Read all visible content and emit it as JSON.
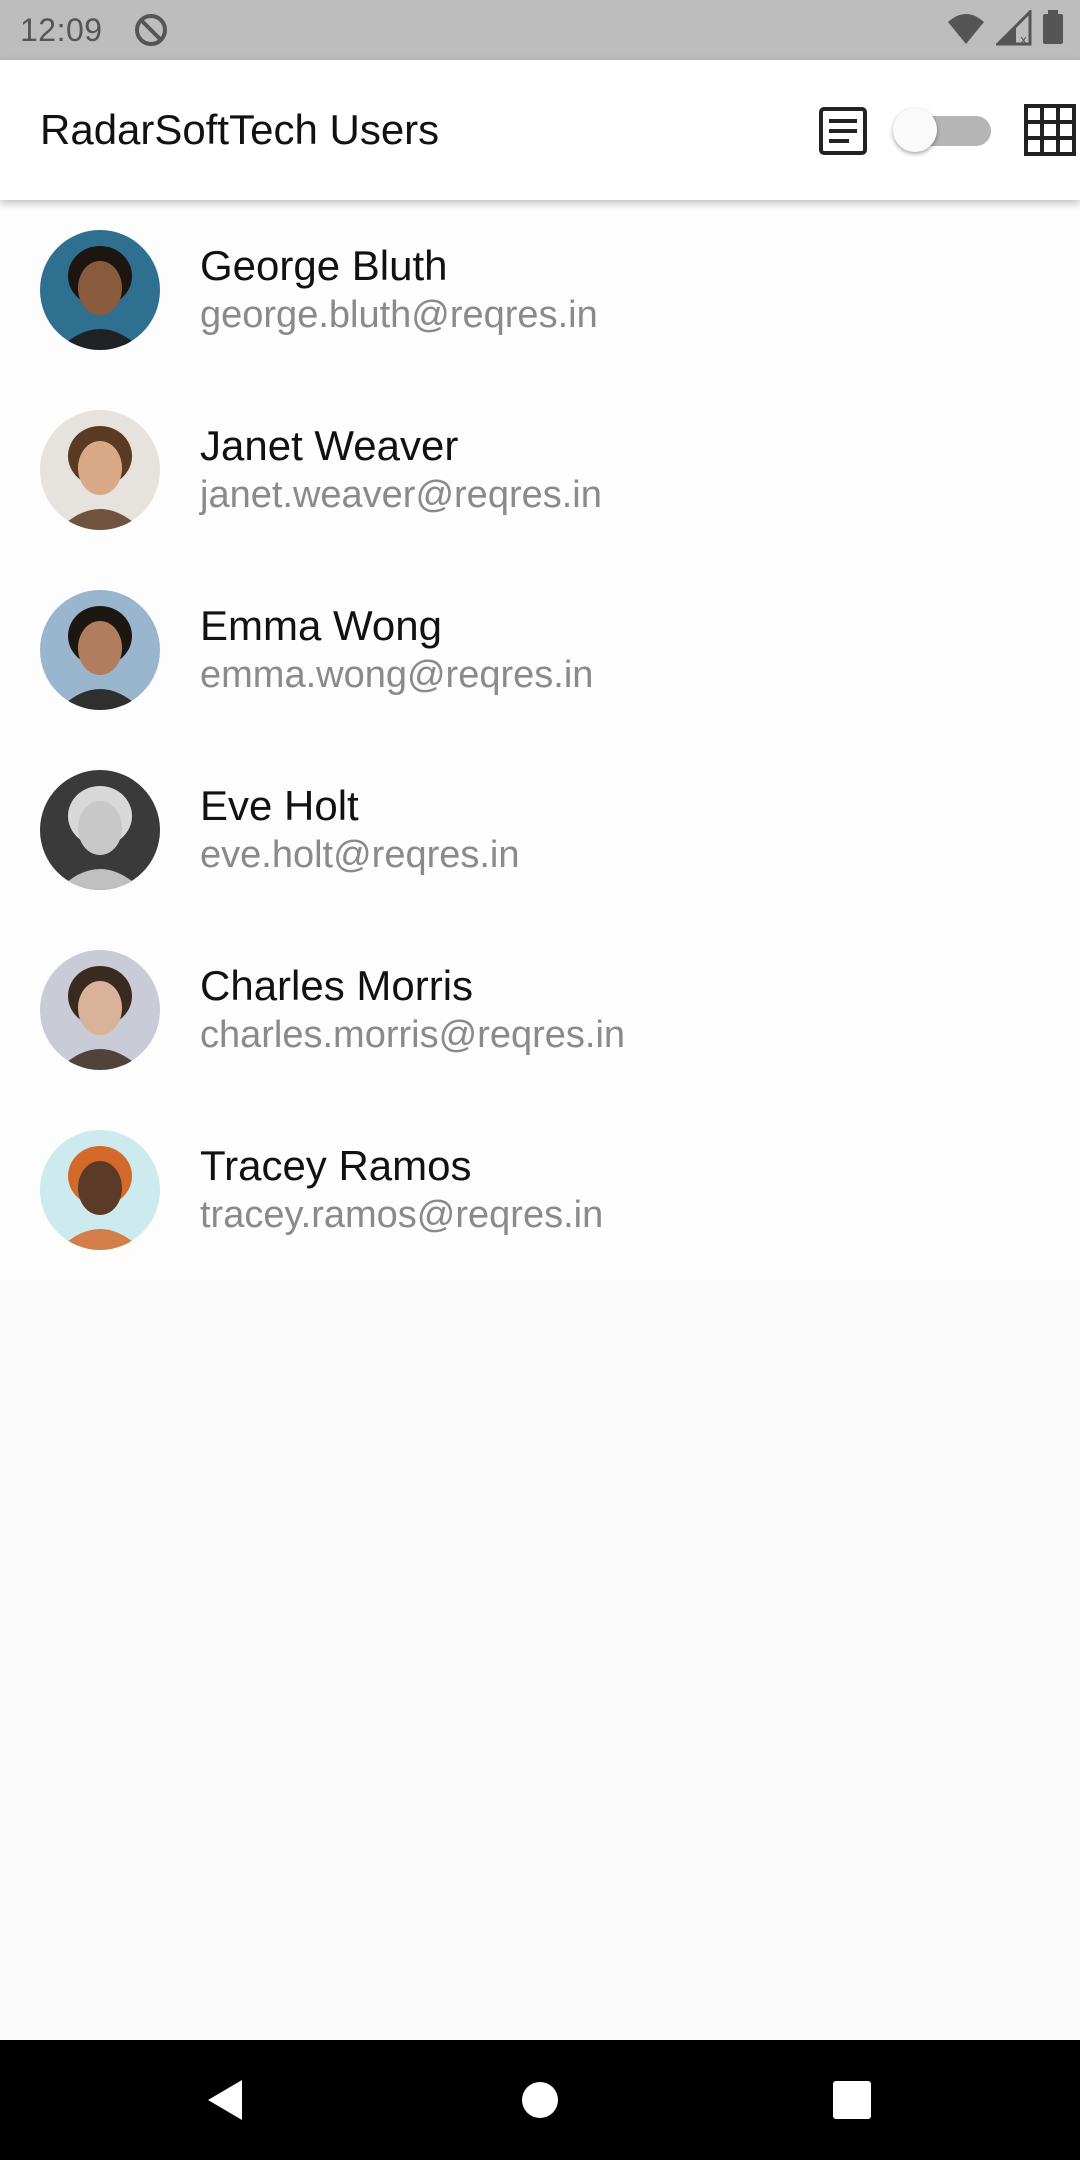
{
  "status_bar": {
    "time": "12:09",
    "icons": [
      "at-sign-icon",
      "wifi-icon",
      "signal-icon",
      "battery-icon"
    ]
  },
  "app_bar": {
    "title": "RadarSoftTech Users",
    "actions": [
      "list-view-icon",
      "view-toggle",
      "grid-view-icon"
    ],
    "toggle_on": false
  },
  "users": [
    {
      "name": "George Bluth",
      "email": "george.bluth@reqres.in",
      "avatar_bg": "#2f6f8f",
      "skin": "#8a5a3c",
      "hair": "#1c1510"
    },
    {
      "name": "Janet Weaver",
      "email": "janet.weaver@reqres.in",
      "avatar_bg": "#e6e2de",
      "skin": "#d9a987",
      "hair": "#5a3a22"
    },
    {
      "name": "Emma Wong",
      "email": "emma.wong@reqres.in",
      "avatar_bg": "#9ab6cf",
      "skin": "#b07d5e",
      "hair": "#1d1712"
    },
    {
      "name": "Eve Holt",
      "email": "eve.holt@reqres.in",
      "avatar_bg": "#3a3a3a",
      "skin": "#c8c8c8",
      "hair": "#d8d8d8"
    },
    {
      "name": "Charles Morris",
      "email": "charles.morris@reqres.in",
      "avatar_bg": "#c9ccd6",
      "skin": "#d8b39a",
      "hair": "#3a2a20"
    },
    {
      "name": "Tracey Ramos",
      "email": "tracey.ramos@reqres.in",
      "avatar_bg": "#cdeaee",
      "skin": "#5c3a28",
      "hair": "#d46a2a"
    }
  ],
  "nav_bar": {
    "buttons": [
      "back-icon",
      "home-icon",
      "recents-icon"
    ]
  }
}
